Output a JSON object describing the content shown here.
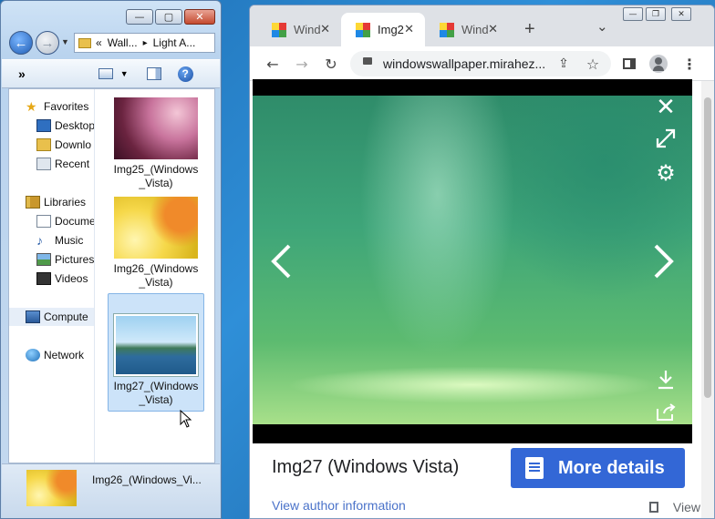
{
  "explorer": {
    "caption_buttons": {
      "minimize": "—",
      "maximize": "▢",
      "close": "✕"
    },
    "address": {
      "chevrons": "«",
      "crumb1": "Wall...",
      "sep": "▸",
      "crumb2": "Light A..."
    },
    "toolbar": {
      "overflow": "»"
    },
    "nav": {
      "favorites": "Favorites",
      "desktop": "Desktop",
      "downloads": "Downlo",
      "recent": "Recent",
      "libraries": "Libraries",
      "documents": "Docume",
      "music": "Music",
      "pictures": "Pictures",
      "videos": "Videos",
      "computer": "Compute",
      "network": "Network"
    },
    "files": [
      {
        "line1": "Img25_(Windows",
        "line2": "_Vista)"
      },
      {
        "line1": "Img26_(Windows",
        "line2": "_Vista)"
      },
      {
        "line1": "Img27_(Windows",
        "line2": "_Vista)"
      }
    ],
    "details": {
      "name": "Img26_(Windows_Vi..."
    }
  },
  "browser": {
    "tabs": [
      {
        "title": "Wind"
      },
      {
        "title": "Img2"
      },
      {
        "title": "Wind"
      }
    ],
    "new_tab": "+",
    "tab_search": "⌄",
    "url": "windowswallpaper.mirahez...",
    "viewer": {
      "caption": "Img27 (Windows Vista)",
      "more_details": "More details",
      "author_link": "View author information",
      "view_link": "View"
    }
  }
}
